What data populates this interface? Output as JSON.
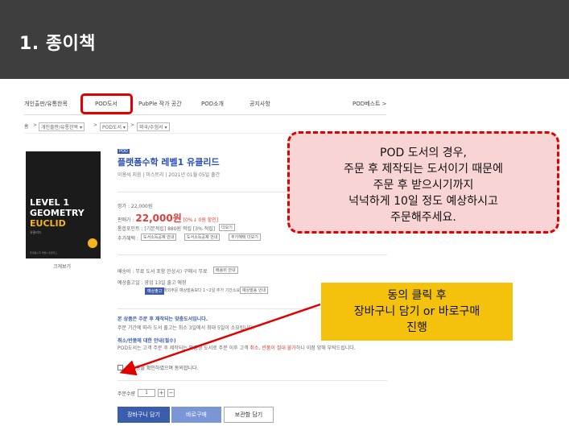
{
  "header": {
    "title": "1. 종이책"
  },
  "nav": {
    "items": [
      "개인출판/유통한목",
      "POD도서",
      "PubPle 작가 공간",
      "POD소개",
      "공지사항"
    ],
    "right": "POD베스트 >"
  },
  "breadcrumb": [
    "홈",
    ">",
    "개인출판/유통한목 ▾",
    ">",
    "POD도서 ▾",
    ">",
    "외국/수험서 ▾"
  ],
  "book": {
    "cover": {
      "line1": "LEVEL 1",
      "line2": "GEOMETRY",
      "line3": "EUCLID",
      "line4": "유클리드",
      "footer": "플랫폼수학 레벨1 유클리드"
    },
    "cover_caption": "크게보기",
    "pod_tag": "POD",
    "title": "플랫폼수학 레벨1 유클리드",
    "meta": "이용석 지음 | 미스트리 | 2021년 01월 05일 출간",
    "list_price": "정가 : 22,000원",
    "sale_label": "판매가 :",
    "sale_price": "22,000원",
    "sale_pct": "[0%↓ 0원 할인]",
    "points": "통합포인트 : [기본적립] 880원 적립 [3% 적립]",
    "points_chip": "더보기",
    "extra_label": "추가혜택 :",
    "extra_chips": [
      "도서소득공제 안내",
      "도서소득공제 안내",
      "추가혜택 더보기"
    ],
    "shipping_label": "배송비 : 무료 도서 포함 인상시) 구매시 무료",
    "shipping_chip": "배송비 안내",
    "delivery_label": "예상출고일 : 영업 13일 출고 예정",
    "delivery_chip_blue": "예상출고",
    "delivery_note": "해외주문 예상발송보다 1~2일 추가 기간소요",
    "delivery_chip": "예상발송 안내",
    "notice_head": "본 상품은 주문 후 제작되는 맞춤도서입니다.",
    "notice_sub": "주문 기간에 따라 도서 출고는 최소 3일에서 최대 5일이 소요됩니다.",
    "cancel_head": "취소/반품에 대한 안내(필수)",
    "cancel_body_a": "POD도서는 고객 주문 후 제작되는 맞춤형 도서로 주문 이후 고객 ",
    "cancel_body_warn": "취소, 반품이 절대 불가",
    "cancel_body_b": "하니 이점 양해 부탁드립니다.",
    "agree": "위 내용을 확인하였으며 동의합니다.",
    "qty_label": "주문수량",
    "qty_value": "1",
    "qty_plus": "+",
    "qty_minus": "−",
    "actions": {
      "cart": "장바구니 담기",
      "buy": "바로구매",
      "gift": "보관함 담기"
    }
  },
  "callout_red": {
    "lines": [
      "POD 도서의 경우,",
      "주문 후 제작되는 도서이기 때문에",
      "주문 후 받으시기까지",
      "넉넉하게 10일 정도 예상하시고",
      "주문해주세요."
    ]
  },
  "callout_yellow": {
    "lines": [
      "동의 클릭 후",
      "장바구니 담기 or 바로구매",
      "진행"
    ]
  },
  "colors": {
    "header_bg": "#3e3e3e",
    "accent_red": "#e00000",
    "link_blue": "#3a5dae",
    "callout_yellow": "#f4c20d",
    "callout_pink": "#f9d4d4"
  }
}
